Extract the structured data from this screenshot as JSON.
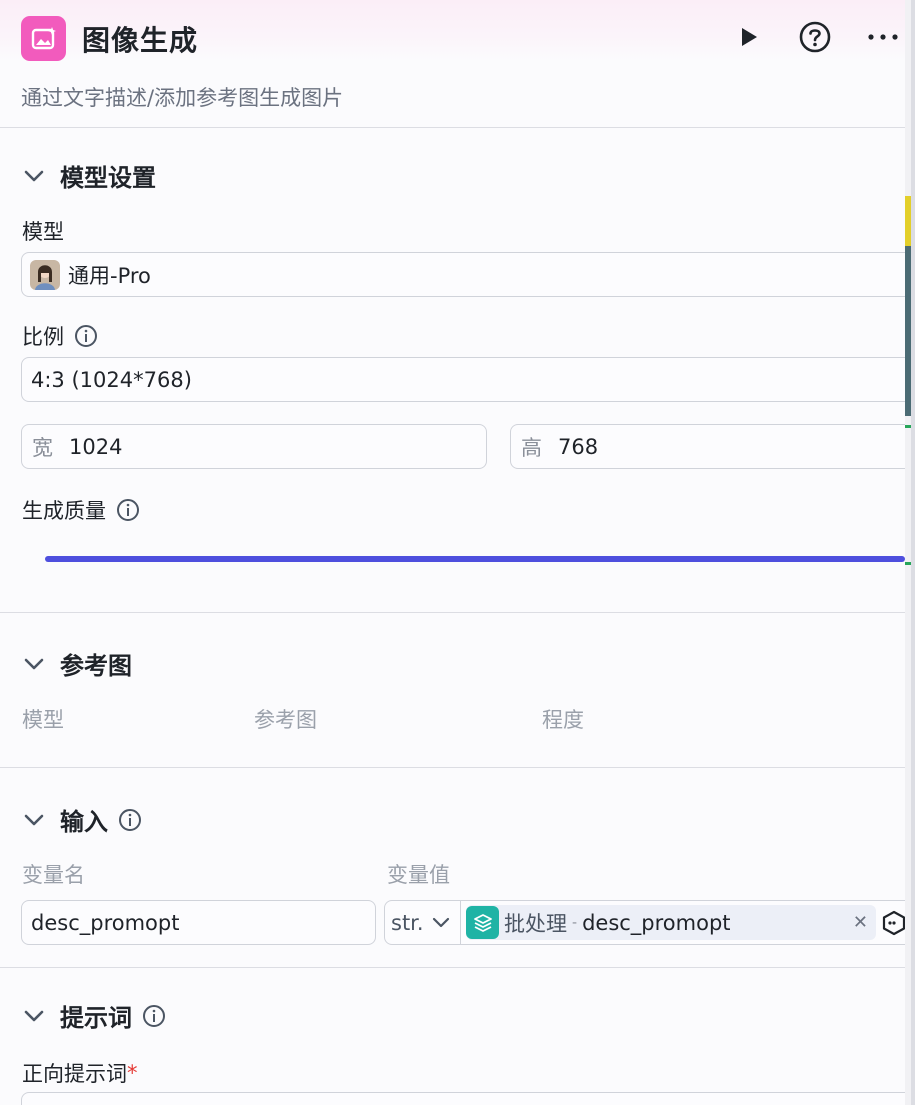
{
  "header": {
    "title": "图像生成",
    "subtitle": "通过文字描述/添加参考图生成图片",
    "icon": "image-generate-icon",
    "icon_color": "#f25bbd",
    "actions": [
      "run-icon",
      "help-icon",
      "more-icon"
    ]
  },
  "model_settings": {
    "title": "模型设置",
    "model_label": "模型",
    "model_value": "通用-Pro",
    "ratio_label": "比例",
    "ratio_value": "4:3 (1024*768)",
    "width_label": "宽",
    "width_value": "1024",
    "height_label": "高",
    "height_value": "768",
    "quality_label": "生成质量",
    "slider_color": "#4e4fde"
  },
  "reference": {
    "title": "参考图",
    "columns": [
      "模型",
      "参考图",
      "程度"
    ]
  },
  "input": {
    "title": "输入",
    "col_name": "变量名",
    "col_value": "变量值",
    "var_name": "desc_promopt",
    "type": "str.",
    "ref_source": "批处理",
    "ref_separator": "-",
    "ref_var": "desc_promopt",
    "ref_badge_color": "#1fb3a5"
  },
  "prompt": {
    "title": "提示词",
    "positive_label": "正向提示词",
    "required_mark": "*"
  }
}
